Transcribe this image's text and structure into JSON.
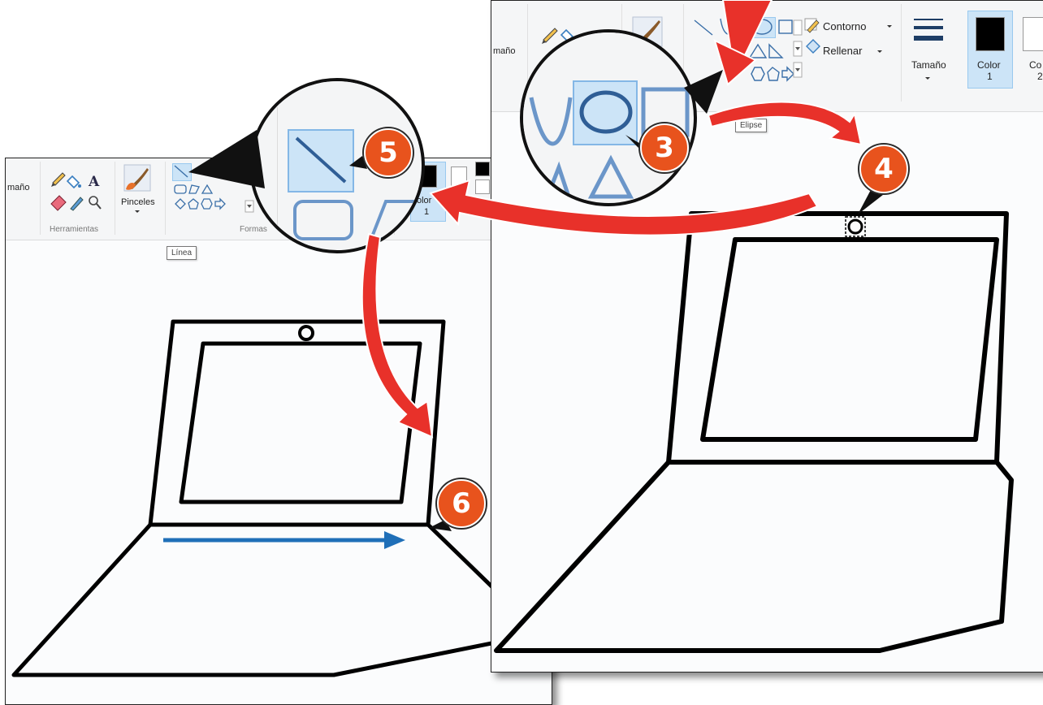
{
  "left_window": {
    "ribbon": {
      "size_fragment": "maño",
      "tools_group_label": "Herramientas",
      "brushes_label": "Pinceles",
      "shapes_group_label": "Formas",
      "color1_label": "Color",
      "color1_number": "1",
      "color1_fragment": "olor"
    },
    "tooltip": "Línea"
  },
  "right_window": {
    "ribbon": {
      "size_fragment": "maño",
      "outline_label": "Contorno",
      "fill_label": "Rellenar",
      "size_label": "Tamaño",
      "color1_label": "Color",
      "color1_number": "1",
      "color2_fragment": "Co",
      "color2_number": "2"
    },
    "tooltip": "Elipse"
  },
  "callouts": [
    "3",
    "4",
    "5",
    "6"
  ],
  "colors": {
    "annotation_red": "#e8312a",
    "badge_orange": "#e8531d",
    "stroke_blue": "#1f6fb8",
    "selection_blue": "#cce4f7",
    "ribbon_bg": "#f5f6f7",
    "canvas_bg": "#fbfcfd"
  },
  "icons": [
    "pencil-icon",
    "fill-bucket-icon",
    "text-icon",
    "eraser-icon",
    "color-picker-icon",
    "magnifier-icon",
    "brush-icon",
    "line-shape-icon",
    "ellipse-shape-icon",
    "rectangle-shape-icon",
    "outline-icon",
    "fill-icon",
    "size-lines-icon",
    "dropdown-arrow-icon"
  ]
}
